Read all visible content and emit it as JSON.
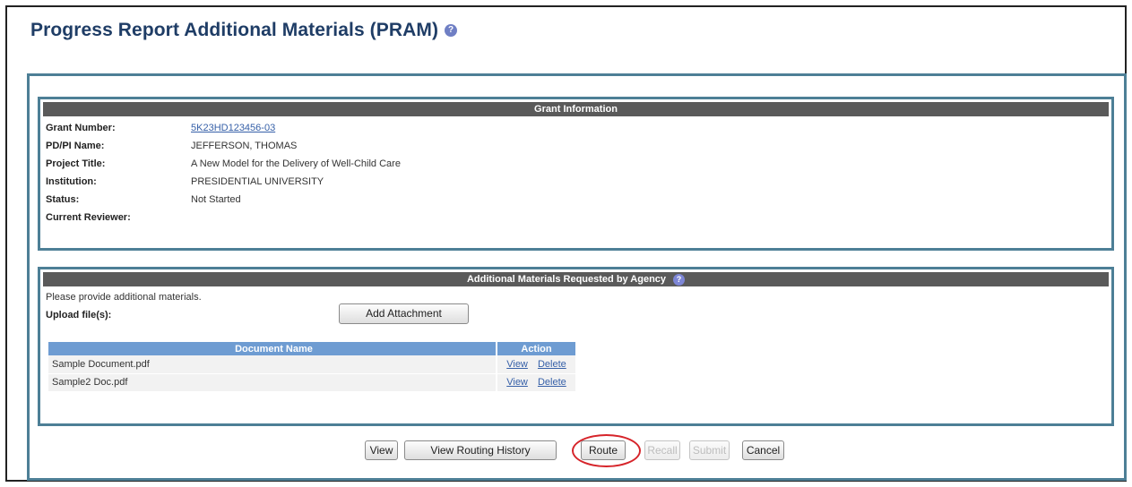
{
  "page": {
    "title": "Progress Report Additional Materials (PRAM)",
    "help_glyph": "?"
  },
  "grant_info": {
    "header": "Grant Information",
    "rows": [
      {
        "label": "Grant Number:",
        "value": "5K23HD123456-03"
      },
      {
        "label": "PD/PI Name:",
        "value": "JEFFERSON, THOMAS"
      },
      {
        "label": "Project Title:",
        "value": "A New Model for the Delivery of Well-Child Care"
      },
      {
        "label": "Institution:",
        "value": "PRESIDENTIAL UNIVERSITY"
      },
      {
        "label": "Status:",
        "value": "Not Started"
      },
      {
        "label": "Current Reviewer:",
        "value": ""
      }
    ]
  },
  "materials": {
    "header": "Additional Materials Requested by Agency",
    "request_text": "Please provide additional materials.",
    "upload_label": "Upload file(s):",
    "add_attachment_label": "Add Attachment",
    "table": {
      "columns": [
        "Document Name",
        "Action"
      ],
      "rows": [
        {
          "name": "Sample Document.pdf",
          "actions": [
            "View",
            "Delete"
          ]
        },
        {
          "name": "Sample2 Doc.pdf",
          "actions": [
            "View",
            "Delete"
          ]
        }
      ]
    }
  },
  "buttons": {
    "view": "View",
    "view_routing_history": "View Routing History",
    "route": "Route",
    "recall": "Recall",
    "submit": "Submit",
    "cancel": "Cancel"
  },
  "colors": {
    "title": "#1f3d66",
    "panel_border": "#4d7f96",
    "section_header": "#5a5a5a",
    "table_header": "#6e9cd2",
    "link": "#3660a8",
    "highlight_circle": "#d6242a"
  }
}
